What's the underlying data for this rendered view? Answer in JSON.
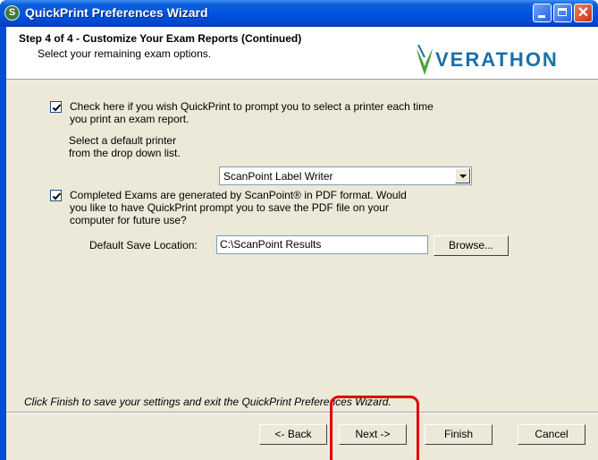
{
  "window": {
    "title": "QuickPrint Preferences Wizard",
    "icon": "app-logo-icon"
  },
  "header": {
    "step_title": "Step 4 of 4 - Customize Your Exam Reports (Continued)",
    "step_subtitle": "Select your remaining exam options.",
    "logo_text": "VERATHON"
  },
  "options": {
    "prompt_printer": {
      "checked": true,
      "line1": "Check here if you wish QuickPrint to prompt you to select a printer each time",
      "line2": "you print an exam report."
    },
    "default_printer": {
      "label_line1": "Select a default printer",
      "label_line2": "from the drop down list.",
      "selected": "ScanPoint Label Writer"
    },
    "save_pdf": {
      "checked": true,
      "line1": "Completed Exams are generated by ScanPoint® in PDF format.  Would",
      "line2": "you like to have QuickPrint prompt you to save the PDF file on your",
      "line3": "computer for future use?"
    },
    "save_location": {
      "label": "Default Save Location:",
      "value": "C:\\ScanPoint Results",
      "browse_label": "Browse..."
    }
  },
  "footer": {
    "status_text": "Click Finish to save your settings and exit the QuickPrint Preferences Wizard.",
    "buttons": {
      "back_label": "<- Back",
      "next_label": "Next ->",
      "finish_label": "Finish",
      "cancel_label": "Cancel"
    }
  },
  "colors": {
    "title_bar": "#0054e3",
    "dialog_bg": "#ece9d8",
    "highlight": "#e00000",
    "logo": "#1a6fa8"
  }
}
